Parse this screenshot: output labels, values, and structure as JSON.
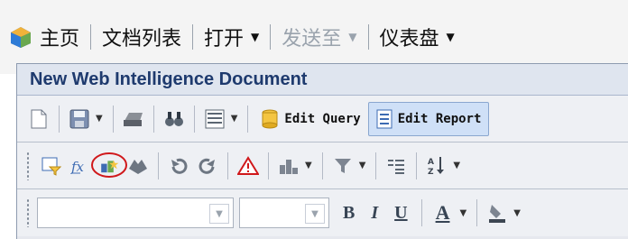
{
  "nav": {
    "home": "主页",
    "doc_list": "文档列表",
    "open": "打开",
    "send_to": "发送至",
    "dashboard": "仪表盘"
  },
  "document": {
    "title": "New Web Intelligence Document"
  },
  "toolbar1": {
    "edit_query": "Edit Query",
    "edit_report": "Edit Report"
  },
  "toolbar3": {
    "bold": "B",
    "italic": "I",
    "underline": "U",
    "font_color": "A"
  },
  "colors": {
    "nav_bg": "#f4f4f4",
    "title_text": "#1e3a6e",
    "active_button_bg": "#cfe0f7",
    "highlight_circle": "#d0181b"
  }
}
